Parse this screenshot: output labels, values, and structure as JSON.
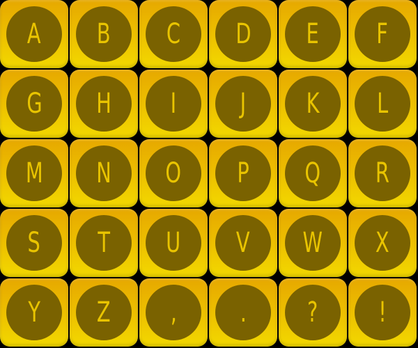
{
  "keypad": {
    "keys": [
      {
        "label": "A"
      },
      {
        "label": "B"
      },
      {
        "label": "C"
      },
      {
        "label": "D"
      },
      {
        "label": "E"
      },
      {
        "label": "F"
      },
      {
        "label": "G"
      },
      {
        "label": "H"
      },
      {
        "label": "I"
      },
      {
        "label": "J"
      },
      {
        "label": "K"
      },
      {
        "label": "L"
      },
      {
        "label": "M"
      },
      {
        "label": "N"
      },
      {
        "label": "O"
      },
      {
        "label": "P"
      },
      {
        "label": "Q"
      },
      {
        "label": "R"
      },
      {
        "label": "S"
      },
      {
        "label": "T"
      },
      {
        "label": "U"
      },
      {
        "label": "V"
      },
      {
        "label": "W"
      },
      {
        "label": "X"
      },
      {
        "label": "Y"
      },
      {
        "label": "Z"
      },
      {
        "label": ","
      },
      {
        "label": "."
      },
      {
        "label": "?"
      },
      {
        "label": "!"
      }
    ]
  },
  "colors": {
    "background": "#000000",
    "key_top": "#e6a800",
    "key_bottom": "#f2d800",
    "key_face": "#7a6200",
    "key_label": "#e9c400"
  }
}
